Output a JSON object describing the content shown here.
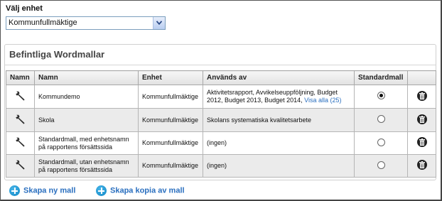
{
  "unit": {
    "label": "Välj enhet",
    "selected": "Kommunfullmäktige"
  },
  "section": {
    "title": "Befintliga Wordmallar"
  },
  "table": {
    "headers": [
      "Namn",
      "Namn",
      "Enhet",
      "Används av",
      "Standardmall",
      ""
    ],
    "rows": [
      {
        "name": "Kommundemo",
        "unit": "Kommunfullmäktige",
        "used_by": "Aktivitetsrapport, Avvikelseuppföljning, Budget 2012, Budget 2013, Budget 2014,",
        "used_by_link": "Visa alla (25)",
        "standard": true
      },
      {
        "name": "Skola",
        "unit": "Kommunfullmäktige",
        "used_by": "Skolans systematiska kvalitetsarbete",
        "used_by_link": "",
        "standard": false
      },
      {
        "name": "Standardmall, med enhetsnamn på rapportens försättssida",
        "unit": "Kommunfullmäktige",
        "used_by": "(ingen)",
        "used_by_link": "",
        "standard": false
      },
      {
        "name": "Standardmall, utan enhetsnamn på rapportens försättssida",
        "unit": "Kommunfullmäktige",
        "used_by": "(ingen)",
        "used_by_link": "",
        "standard": false
      }
    ]
  },
  "actions": {
    "new_template": "Skapa ny mall",
    "copy_template": "Skapa kopia av mall"
  },
  "icons": {
    "edit": "wrench-icon",
    "delete": "trash-icon",
    "add": "plus-circle-icon",
    "dropdown": "chevron-down-icon"
  },
  "colors": {
    "link": "#2a6fbf",
    "add_icon": "#1a96d4",
    "alt_row": "#ebebeb"
  }
}
